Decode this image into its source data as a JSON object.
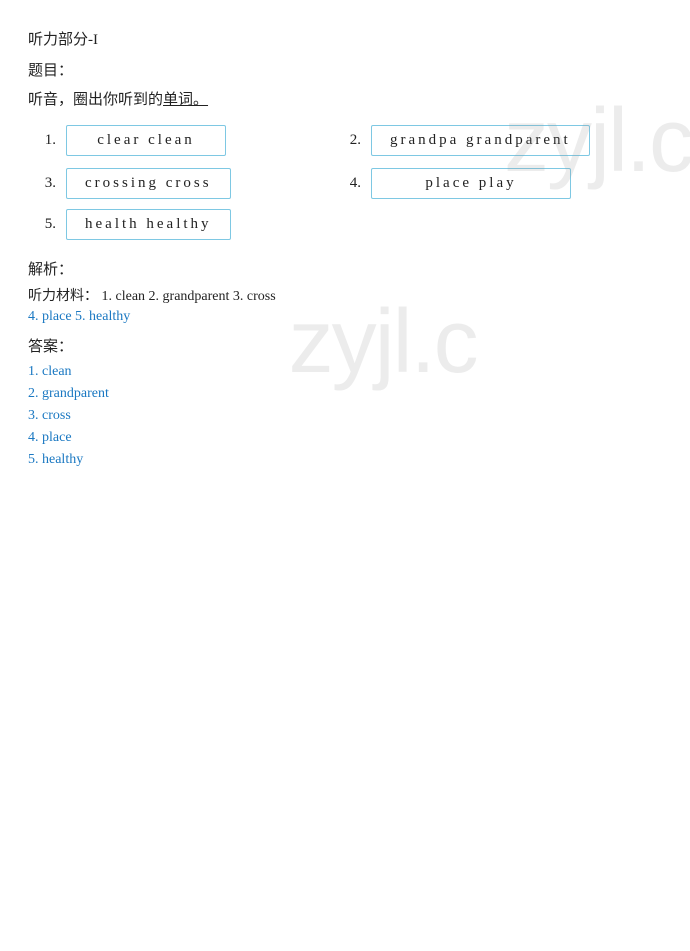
{
  "section": {
    "title": "听力部分-I",
    "tiji_label": "题目：",
    "instruction_prefix": "听音，圈出你听到的单词。",
    "instruction_underline": "圈出你听到的单词。"
  },
  "items": [
    {
      "num": "1.",
      "words": "clear   clean"
    },
    {
      "num": "2.",
      "words": "grandpa   grandparent"
    },
    {
      "num": "3.",
      "words": "crossing   cross"
    },
    {
      "num": "4.",
      "words": "place   play"
    },
    {
      "num": "5.",
      "words": "health   healthy"
    }
  ],
  "analysis": {
    "title": "解析：",
    "listening_label": "听力材料：",
    "listening_content": " 1. clean 2. grandparent 3. cross",
    "listening_line2": "4. place 5. healthy",
    "answers_title": "答案：",
    "answers": [
      {
        "num": "1.",
        "val": "clean"
      },
      {
        "num": "2.",
        "val": "grandparent"
      },
      {
        "num": "3.",
        "val": "cross"
      },
      {
        "num": "4.",
        "val": "place"
      },
      {
        "num": "5.",
        "val": "healthy"
      }
    ]
  },
  "watermark": "zyjl.cr"
}
